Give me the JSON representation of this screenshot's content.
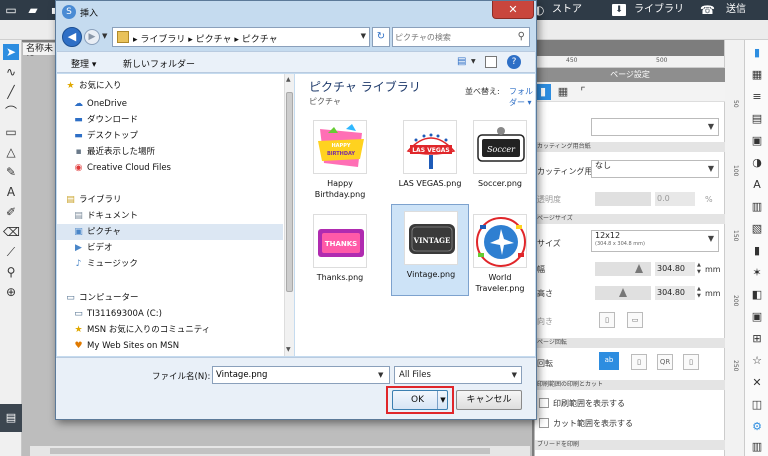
{
  "app": {
    "topbar": {
      "store": "ストア",
      "library": "ライブラリ",
      "send": "送信"
    },
    "doc_tab": "名称未設",
    "top_ruler": [
      "450",
      "500"
    ],
    "right_ruler": [
      "50",
      "100",
      "150",
      "200",
      "250"
    ]
  },
  "page_settings": {
    "header": "ページ設定",
    "section_cutting": "カッティング用台紙",
    "cutting_mat_label": "カッティング用台紙",
    "cutting_mat_value": "なし",
    "transparency_label": "透明度",
    "transparency_value": "0.0",
    "transparency_unit": "%",
    "section_page_size": "ページサイズ",
    "size_label": "サイズ",
    "size_value": "12x12",
    "size_sub": "(304.8 x 304.8 mm)",
    "width_label": "幅",
    "width_value": "304.80",
    "height_label": "高さ",
    "height_value": "304.80",
    "unit_mm": "mm",
    "orientation_label": "向き",
    "section_rotate": "ページ回転",
    "rotate_label": "回転",
    "section_print_cut": "印刷範囲の印刷とカット",
    "show_print_area": "印刷範囲を表示する",
    "show_cut_area": "カット範囲を表示する",
    "section_bleed": "ブリードを印刷"
  },
  "dialog": {
    "title": "挿入",
    "breadcrumb": "▸ ライブラリ ▸ ピクチャ ▸ ピクチャ",
    "search_placeholder": "ピクチャの検索",
    "organize": "整理 ▾",
    "new_folder": "新しいフォルダー",
    "nav_items": [
      {
        "icon": "★",
        "label": "お気に入り",
        "color": "#e0a800"
      },
      {
        "icon": "☁",
        "label": "OneDrive",
        "color": "#2e6fc6"
      },
      {
        "icon": "▬",
        "label": "ダウンロード",
        "color": "#2e6fc6"
      },
      {
        "icon": "▬",
        "label": "デスクトップ",
        "color": "#2e6fc6"
      },
      {
        "icon": "▪",
        "label": "最近表示した場所",
        "color": "#6a7a8a"
      },
      {
        "icon": "◉",
        "label": "Creative Cloud Files",
        "color": "#e03a3a"
      },
      {
        "icon": "▤",
        "label": "ライブラリ",
        "color": "#c9a227"
      },
      {
        "icon": "▤",
        "label": "ドキュメント",
        "color": "#7a8a9a"
      },
      {
        "icon": "▣",
        "label": "ピクチャ",
        "color": "#4a86c8"
      },
      {
        "icon": "▶",
        "label": "ビデオ",
        "color": "#4a86c8"
      },
      {
        "icon": "♪",
        "label": "ミュージック",
        "color": "#4a86c8"
      },
      {
        "icon": "▭",
        "label": "コンピューター",
        "color": "#4a6a8a"
      },
      {
        "icon": "▭",
        "label": "TI31169300A (C:)",
        "color": "#4a6a8a"
      },
      {
        "icon": "★",
        "label": "MSN お気に入りのコミュニティ",
        "color": "#e0a800"
      },
      {
        "icon": "♥",
        "label": "My Web Sites on MSN",
        "color": "#e07a00"
      }
    ],
    "library_title": "ピクチャ ライブラリ",
    "library_subtitle": "ピクチャ",
    "sort_label": "並べ替え:",
    "sort_value": "フォルダー ▾",
    "files": [
      {
        "name": "Happy Birthday.png",
        "image_text": "HAPPY BIRTHDAY",
        "colors": [
          "#ff6fb5",
          "#ffd21f",
          "#66cc33"
        ]
      },
      {
        "name": "LAS VEGAS.png",
        "image_text": "LAS VEGAS",
        "colors": [
          "#e0262a",
          "#1e5bb8",
          "#ffffff"
        ]
      },
      {
        "name": "Soccer.png",
        "image_text": "Soccer",
        "colors": [
          "#222222",
          "#ffffff",
          "#888888"
        ]
      },
      {
        "name": "Thanks.png",
        "image_text": "THANKS",
        "colors": [
          "#b02bb0",
          "#ff5aa8",
          "#ffffff"
        ]
      },
      {
        "name": "Vintage.png",
        "image_text": "VINTAGE",
        "colors": [
          "#3a3a3a",
          "#ffffff",
          "#888888"
        ]
      },
      {
        "name": "World Traveler.png",
        "image_text": "",
        "colors": [
          "#2e7fd1",
          "#ffffff",
          "#e0262a"
        ]
      }
    ],
    "filename_label": "ファイル名(N):",
    "filename_value": "Vintage.png",
    "filetype_value": "All Files",
    "ok": "OK",
    "cancel": "キャンセル",
    "accent": "#2e6fc6",
    "highlight": "#e0262a"
  }
}
